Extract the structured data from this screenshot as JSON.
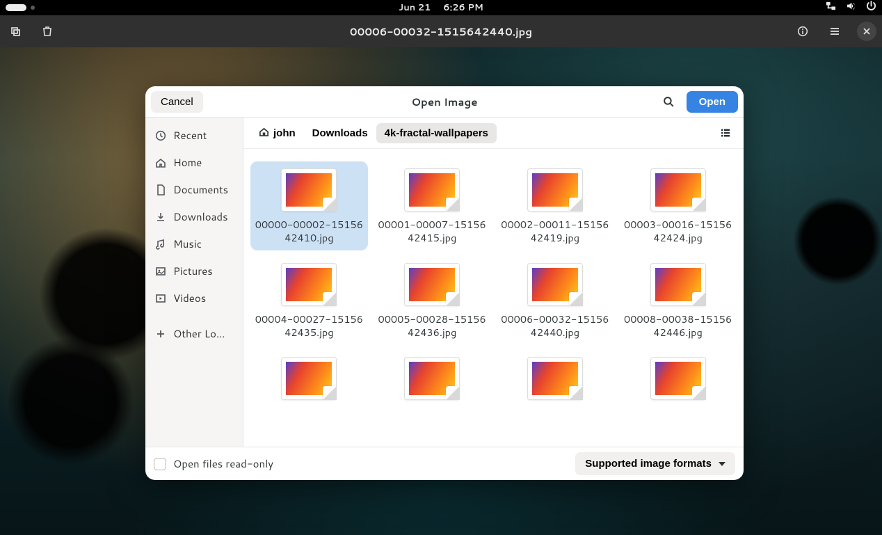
{
  "topbar": {
    "date": "Jun 21",
    "time": "6:26 PM"
  },
  "app": {
    "title": "00006-00032-1515642440.jpg"
  },
  "dialog": {
    "cancel": "Cancel",
    "title": "Open Image",
    "open": "Open",
    "readonly": "Open files read-only",
    "filter": "Supported image formats"
  },
  "sidebar": [
    {
      "key": "recent",
      "label": "Recent"
    },
    {
      "key": "home",
      "label": "Home"
    },
    {
      "key": "documents",
      "label": "Documents"
    },
    {
      "key": "downloads",
      "label": "Downloads"
    },
    {
      "key": "music",
      "label": "Music"
    },
    {
      "key": "pictures",
      "label": "Pictures"
    },
    {
      "key": "videos",
      "label": "Videos"
    },
    {
      "key": "other",
      "label": "Other Lo…"
    }
  ],
  "breadcrumbs": [
    {
      "label": "john",
      "home": true
    },
    {
      "label": "Downloads"
    },
    {
      "label": "4k-fractal-wallpapers",
      "active": true
    }
  ],
  "files": [
    {
      "name": "00000-00002-1515642410.jpg",
      "selected": true
    },
    {
      "name": "00001-00007-1515642415.jpg"
    },
    {
      "name": "00002-00011-1515642419.jpg"
    },
    {
      "name": "00003-00016-1515642424.jpg"
    },
    {
      "name": "00004-00027-1515642435.jpg"
    },
    {
      "name": "00005-00028-1515642436.jpg"
    },
    {
      "name": "00006-00032-1515642440.jpg"
    },
    {
      "name": "00008-00038-1515642446.jpg"
    },
    {
      "name": ""
    },
    {
      "name": ""
    },
    {
      "name": ""
    },
    {
      "name": ""
    }
  ]
}
